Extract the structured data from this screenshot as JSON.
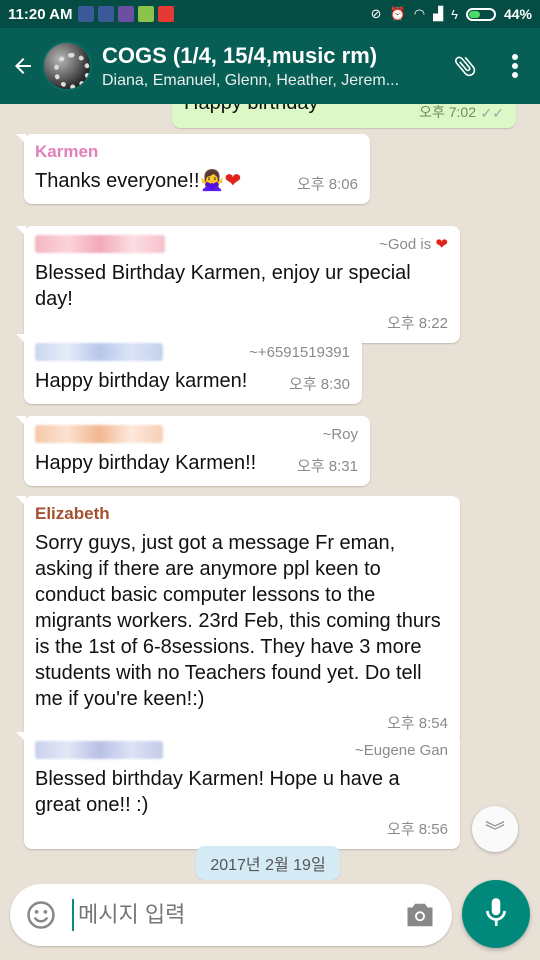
{
  "status_bar": {
    "time": "11:20 AM",
    "battery": "44%",
    "battery_level": 0.44,
    "icons_left": [
      "facebook-icon",
      "facebook-icon",
      "app-icon",
      "app-icon",
      "app-icon"
    ],
    "icons_right": [
      "mute-icon",
      "alarm-icon",
      "wifi-icon",
      "signal-icon",
      "charging-icon"
    ]
  },
  "header": {
    "title": "COGS (1/4, 15/4,music rm)",
    "members": "Diana, Emanuel, Glenn, Heather, Jerem..."
  },
  "previous_message": {
    "text": "Happy birthday",
    "time": "오후 7:02"
  },
  "messages": [
    {
      "sender": "Karmen",
      "sender_color": "#e27fb8",
      "text": "Thanks everyone!!",
      "emoji": "🙅‍♀️",
      "heart": "❤",
      "time": "오후 8:06"
    },
    {
      "alias": "~God is",
      "alias_heart": "❤",
      "text": "Blessed Birthday Karmen, enjoy ur special day!",
      "time": "오후 8:22"
    },
    {
      "alias": "~+6591519391",
      "text": "Happy birthday karmen!",
      "time": "오후 8:30"
    },
    {
      "alias": "~Roy",
      "text": "Happy birthday Karmen!!",
      "time": "오후 8:31"
    },
    {
      "sender": "Elizabeth",
      "sender_color": "#a5512f",
      "text": "Sorry guys, just got a message Fr eman, asking if there are anymore ppl keen to conduct basic computer lessons to the migrants workers. 23rd Feb, this coming thurs is the 1st of 6-8sessions. They have 3 more students with no Teachers found yet. Do tell me if you're keen!:)",
      "time": "오후 8:54"
    },
    {
      "alias": "~Eugene Gan",
      "text": "Blessed birthday Karmen! Hope u have a great one!! :)",
      "time": "오후 8:56"
    }
  ],
  "date_chip": "2017년 2월 19일",
  "composer": {
    "placeholder": "메시지 입력"
  },
  "colors": {
    "header": "#075e54",
    "accent": "#00897b",
    "outgoing_bubble": "#dcf8c6",
    "chat_bg": "#e8e1d6"
  }
}
